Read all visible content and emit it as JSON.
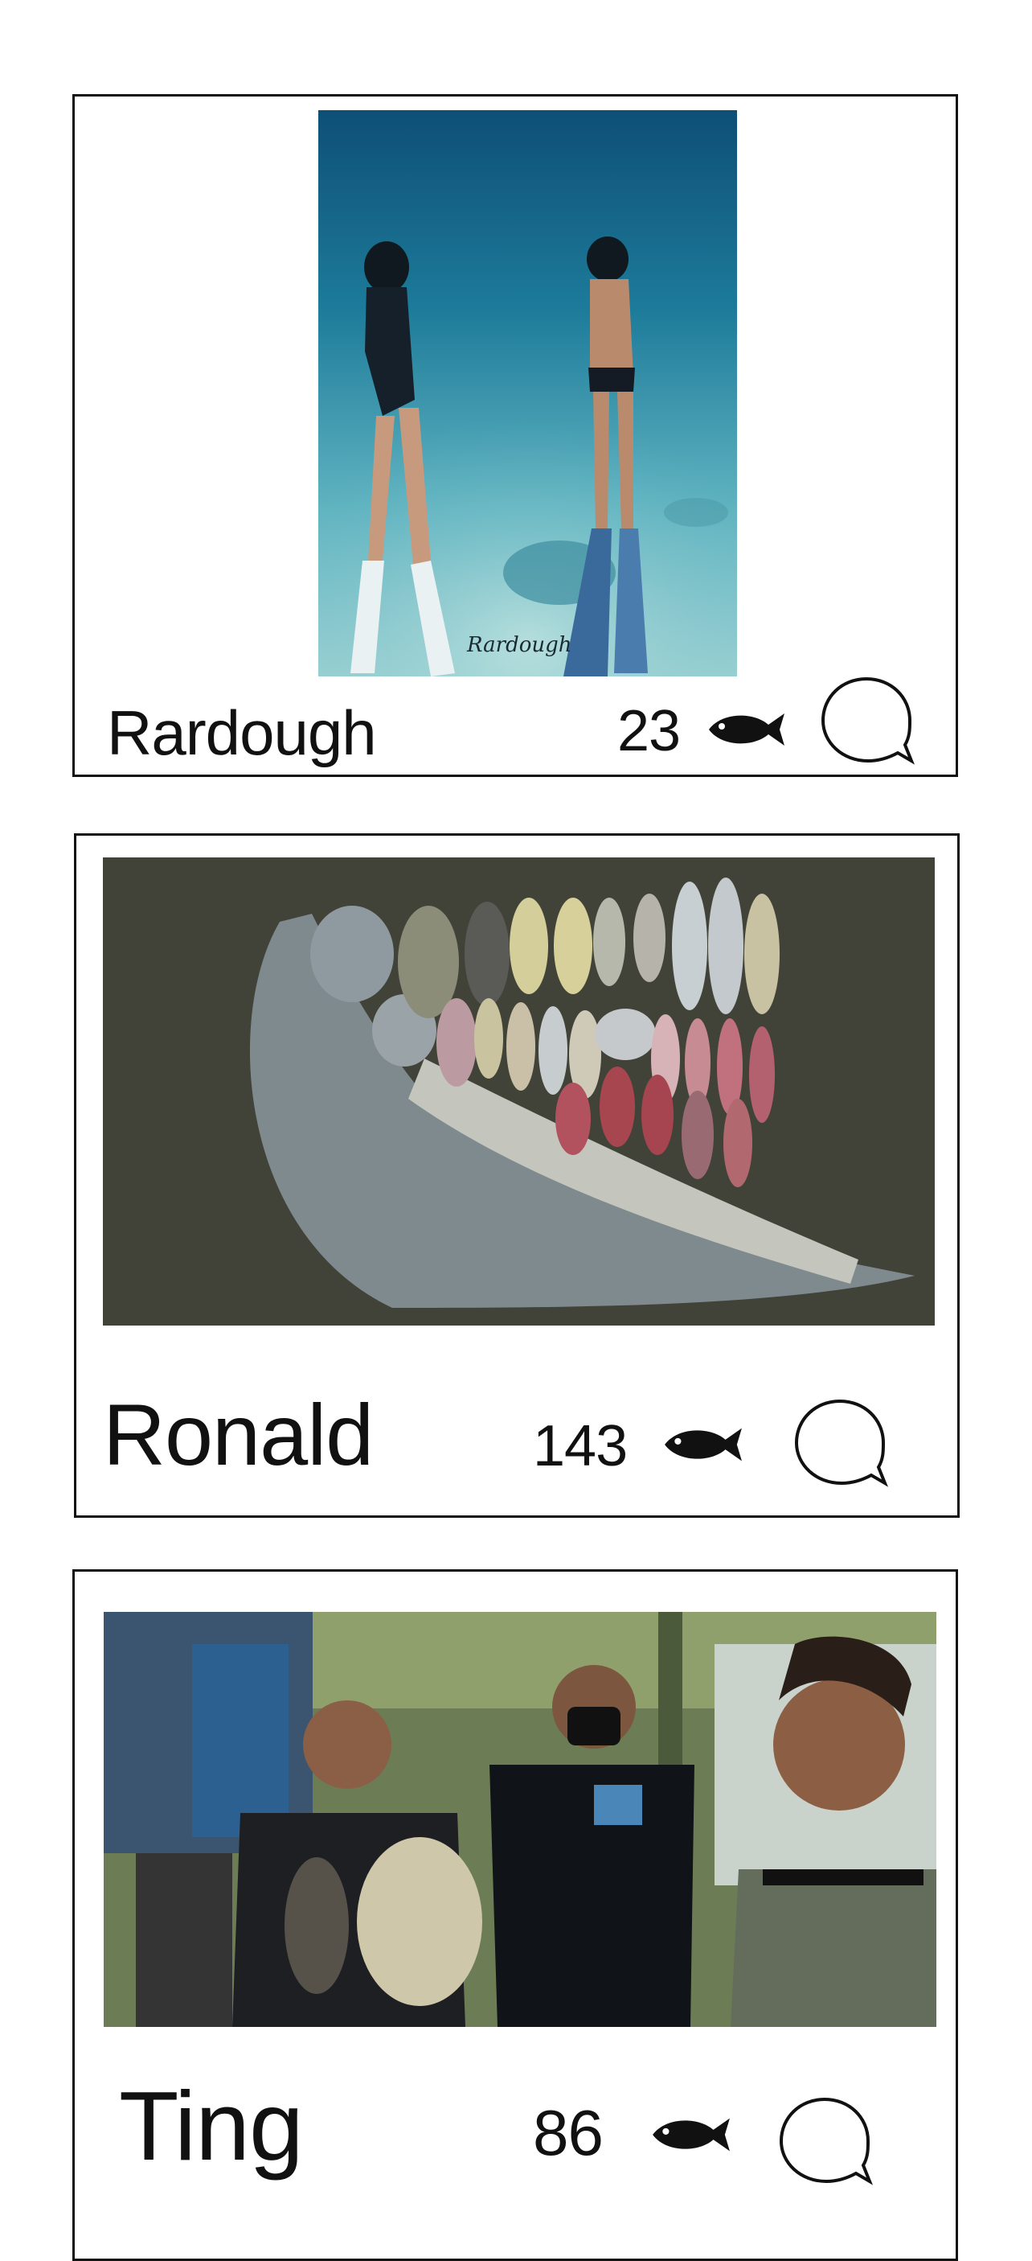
{
  "posts": [
    {
      "user": "Rardough",
      "catch_count": "23",
      "watermark": "Rardough",
      "photo_description_icon": "underwater-freedivers-photo",
      "fish_icon": "fish-icon",
      "comment_icon": "speech-bubble-icon"
    },
    {
      "user": "Ronald",
      "catch_count": "143",
      "photo_description_icon": "octopus-and-fish-catch-photo",
      "fish_icon": "fish-icon",
      "comment_icon": "speech-bubble-icon"
    },
    {
      "user": "Ting",
      "catch_count": "86",
      "photo_description_icon": "spearfishers-group-selfie-photo",
      "fish_icon": "fish-icon",
      "comment_icon": "speech-bubble-icon"
    }
  ],
  "colors": {
    "border": "#111111",
    "background": "#ffffff",
    "ocean": "#1f6f8b"
  }
}
